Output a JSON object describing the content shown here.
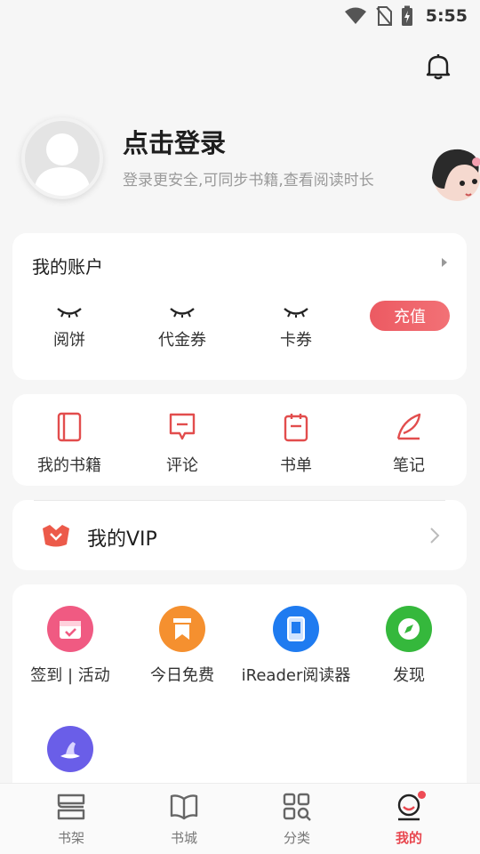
{
  "status_bar": {
    "time": "5:55"
  },
  "profile": {
    "title": "点击登录",
    "subtitle": "登录更安全,可同步书籍,查看阅读时长"
  },
  "account": {
    "title": "我的账户",
    "items": [
      {
        "label": "阅饼"
      },
      {
        "label": "代金券"
      },
      {
        "label": "卡券"
      }
    ],
    "recharge_label": "充值"
  },
  "quick": {
    "items": [
      {
        "label": "我的书籍",
        "icon": "book-icon"
      },
      {
        "label": "评论",
        "icon": "comment-icon"
      },
      {
        "label": "书单",
        "icon": "booklist-icon"
      },
      {
        "label": "笔记",
        "icon": "feather-icon"
      }
    ]
  },
  "vip": {
    "label": "我的VIP"
  },
  "tools": {
    "items": [
      {
        "label": "签到 | 活动",
        "icon": "calendar-icon",
        "color": "#f05a82"
      },
      {
        "label": "今日免费",
        "icon": "bookmark-icon",
        "color": "#f5902f"
      },
      {
        "label": "iReader阅读器",
        "icon": "tablet-icon",
        "color": "#1f7bf0"
      },
      {
        "label": "发现",
        "icon": "compass-icon",
        "color": "#35b83c"
      },
      {
        "label": "",
        "icon": "bottle-icon",
        "color": "#6a5ee8"
      }
    ]
  },
  "tabbar": {
    "items": [
      {
        "label": "书架",
        "icon": "bookshelf-icon"
      },
      {
        "label": "书城",
        "icon": "book-store-icon"
      },
      {
        "label": "分类",
        "icon": "category-icon"
      },
      {
        "label": "我的",
        "icon": "profile-icon"
      }
    ],
    "active_index": 3,
    "accent": "#e8474f"
  }
}
